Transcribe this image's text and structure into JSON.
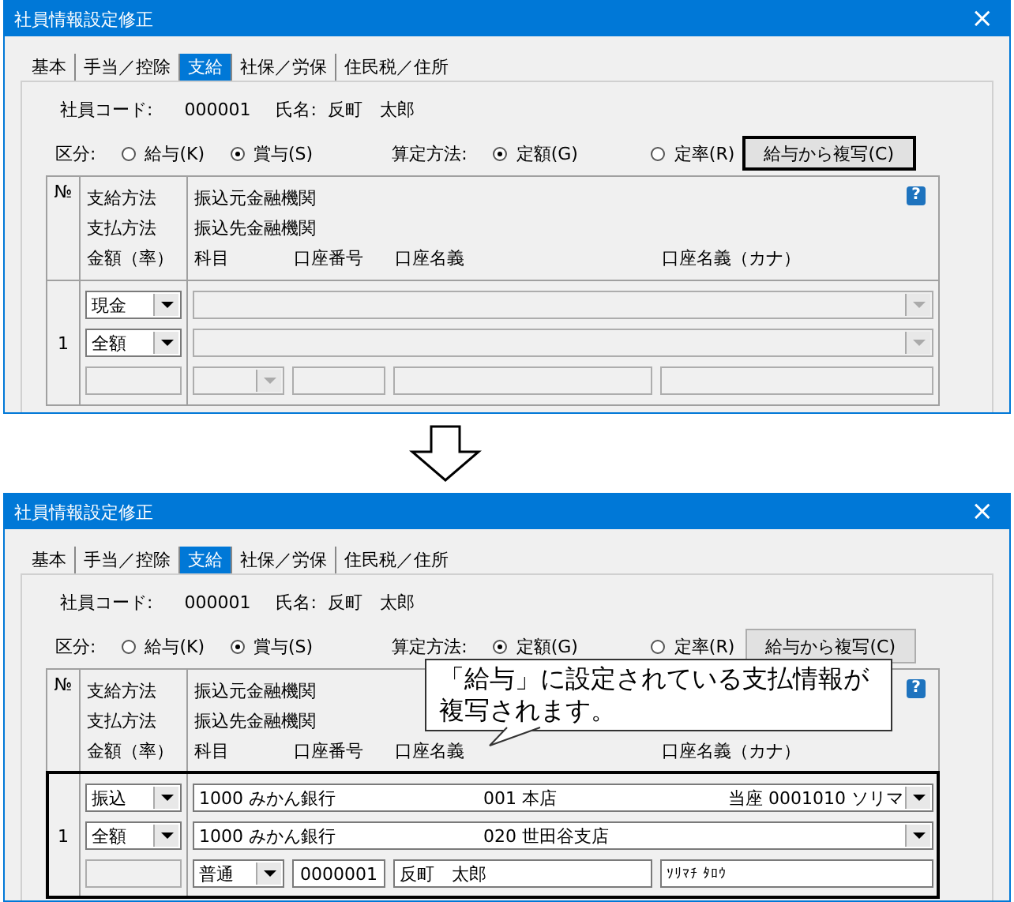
{
  "panels": [
    {
      "title": "社員情報設定修正",
      "close": "×",
      "tabs": [
        {
          "label": "基本",
          "selected": false
        },
        {
          "label": "手当／控除",
          "selected": false
        },
        {
          "label": "支給",
          "selected": true
        },
        {
          "label": "社保／労保",
          "selected": false
        },
        {
          "label": "住民税／住所",
          "selected": false
        }
      ],
      "employee": {
        "code_label": "社員コード:",
        "code": "000001",
        "name_label": "氏名:",
        "name": "反町　太郎"
      },
      "category": {
        "label": "区分:",
        "options": [
          {
            "label": "給与(K)",
            "selected": false
          },
          {
            "label": "賞与(S)",
            "selected": true
          }
        ]
      },
      "method": {
        "label": "算定方法:",
        "options": [
          {
            "label": "定額(G)",
            "selected": true
          },
          {
            "label": "定率(R)",
            "selected": false
          }
        ]
      },
      "copy_button": {
        "label": "給与から複写(C)",
        "highlighted": true
      },
      "table": {
        "no_header": "№",
        "col2_headers": [
          "支給方法",
          "支払方法",
          "金額（率）"
        ],
        "col3_headers": [
          "振込元金融機関",
          "振込先金融機関"
        ],
        "line3_headers": [
          "科目",
          "口座番号",
          "口座名義",
          "口座名義（カナ）"
        ],
        "help": "?",
        "rows": [
          {
            "no": "1",
            "payment": "現金",
            "amount": "全額",
            "disabled": true
          }
        ]
      }
    },
    {
      "title": "社員情報設定修正",
      "close": "×",
      "tabs": [
        {
          "label": "基本",
          "selected": false
        },
        {
          "label": "手当／控除",
          "selected": false
        },
        {
          "label": "支給",
          "selected": true
        },
        {
          "label": "社保／労保",
          "selected": false
        },
        {
          "label": "住民税／住所",
          "selected": false
        }
      ],
      "employee": {
        "code_label": "社員コード:",
        "code": "000001",
        "name_label": "氏名:",
        "name": "反町　太郎"
      },
      "category": {
        "label": "区分:",
        "options": [
          {
            "label": "給与(K)",
            "selected": false
          },
          {
            "label": "賞与(S)",
            "selected": true
          }
        ]
      },
      "method": {
        "label": "算定方法:",
        "options": [
          {
            "label": "定額(G)",
            "selected": true
          },
          {
            "label": "定率(R)",
            "selected": false
          }
        ]
      },
      "copy_button": {
        "label": "給与から複写(C)",
        "highlighted": false
      },
      "table": {
        "no_header": "№",
        "col2_headers": [
          "支給方法",
          "支払方法",
          "金額（率）"
        ],
        "col3_headers": [
          "振込元金融機関",
          "振込先金融機関"
        ],
        "line3_headers": [
          "科目",
          "口座番号",
          "口座名義",
          "口座名義（カナ）"
        ],
        "help": "?",
        "rows": [
          {
            "no": "1",
            "payment": "振込",
            "amount": "全額",
            "source_bank": "1000 みかん銀行",
            "source_branch": "001 本店",
            "source_account": "当座 0001010 ソリマ",
            "dest_bank": "1000 みかん銀行",
            "dest_branch": "020 世田谷支店",
            "account_type": "普通",
            "account_no": "0000001",
            "account_name": "反町　太郎",
            "account_kana": "ｿﾘﾏﾁ ﾀﾛｳ",
            "disabled": false,
            "highlighted": true
          }
        ]
      },
      "callout": {
        "lines": [
          "「給与」に設定されている支払情報が",
          "複写されます。"
        ]
      }
    }
  ]
}
